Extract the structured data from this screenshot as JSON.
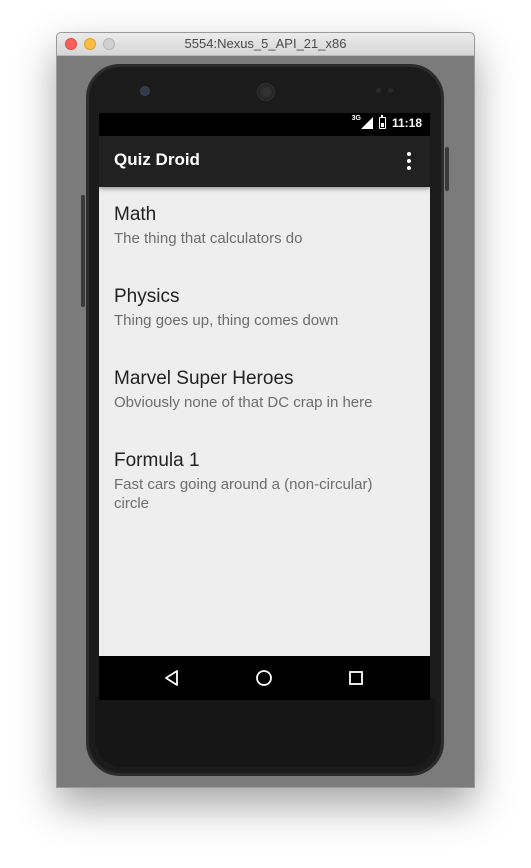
{
  "window": {
    "title": "5554:Nexus_5_API_21_x86"
  },
  "statusbar": {
    "network_label": "3G",
    "time": "11:18"
  },
  "appbar": {
    "title": "Quiz Droid"
  },
  "quizzes": [
    {
      "title": "Math",
      "description": "The thing that calculators do"
    },
    {
      "title": "Physics",
      "description": "Thing goes up, thing comes down"
    },
    {
      "title": "Marvel Super Heroes",
      "description": "Obviously none of that DC crap in here"
    },
    {
      "title": "Formula 1",
      "description": "Fast cars going around a (non-circular) circle"
    }
  ],
  "colors": {
    "appbar": "#212121",
    "background": "#eeeeee",
    "title_text": "#222222",
    "subtitle_text": "#6d6d6d"
  },
  "icons": {
    "back": "back-triangle-icon",
    "home": "home-circle-icon",
    "recent": "recent-apps-square-icon",
    "overflow": "overflow-menu-icon"
  }
}
